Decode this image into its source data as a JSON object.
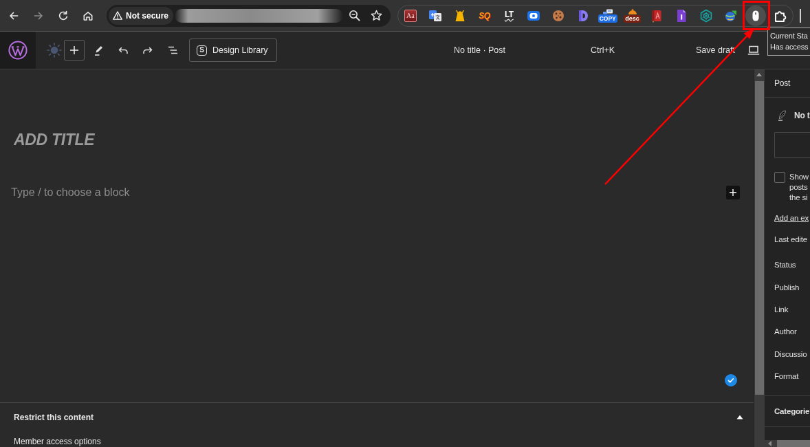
{
  "browser": {
    "nav_buttons": [
      {
        "kind": "back",
        "disabled": false
      },
      {
        "kind": "forward",
        "disabled": true
      },
      {
        "kind": "reload",
        "disabled": false
      },
      {
        "kind": "home",
        "disabled": false
      }
    ],
    "security_label": "Not secure",
    "extensions": [
      {
        "kind": "dictionary",
        "label": "Aa",
        "active": false
      },
      {
        "kind": "translate",
        "active": false
      },
      {
        "kind": "bag",
        "active": false
      },
      {
        "kind": "sq",
        "label": "SQ",
        "active": false
      },
      {
        "kind": "lt",
        "label": "LT",
        "active": false
      },
      {
        "kind": "record",
        "active": false
      },
      {
        "kind": "cookie",
        "active": false
      },
      {
        "kind": "d-shape",
        "active": false
      },
      {
        "kind": "copy",
        "label": "COPY",
        "active": false
      },
      {
        "kind": "desc",
        "label": "desc",
        "active": false
      },
      {
        "kind": "book",
        "active": false
      },
      {
        "kind": "document",
        "active": false
      },
      {
        "kind": "hexagon",
        "active": false
      },
      {
        "kind": "globe",
        "active": false
      },
      {
        "kind": "mouse",
        "active": true
      },
      {
        "kind": "puzzle",
        "active": false
      }
    ],
    "tooltip": [
      "Current Sta",
      "Has access"
    ]
  },
  "header": {
    "design_library": {
      "icon_text": "S",
      "label": "Design Library"
    },
    "document_title": "No title · Post",
    "shortcut": "Ctrl+K",
    "save_draft": "Save draft"
  },
  "editor": {
    "title": {
      "placeholder": "ADD TITLE"
    },
    "block": {
      "placeholder": "Type / to choose a block"
    }
  },
  "meta_box": {
    "title": "Restrict this content",
    "expanded": true,
    "subtitle": "Member access options"
  },
  "sidebar": {
    "tab": "Post",
    "post_title": "No t",
    "front_page_option": {
      "label_lines": [
        "Show",
        "posts",
        "the si"
      ],
      "checked": false
    },
    "excerpt_link": "Add an ex",
    "last_edited": "Last edite",
    "fields": [
      "Status",
      "Publish",
      "Link",
      "Author",
      "Discussio",
      "Format"
    ],
    "sections": [
      "Categorie"
    ]
  }
}
